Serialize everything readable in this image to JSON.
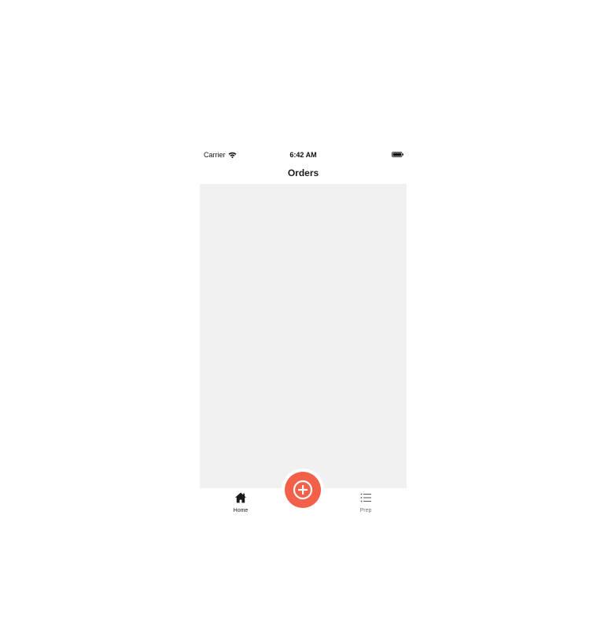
{
  "status_bar": {
    "carrier": "Carrier",
    "time": "6:42 AM",
    "wifi_icon": "wifi-icon",
    "battery_icon": "battery-icon"
  },
  "nav": {
    "title": "Orders"
  },
  "tabs": [
    {
      "label": "Home",
      "icon": "home-icon",
      "active": true
    },
    {
      "label": "Prep",
      "icon": "list-icon",
      "active": false
    }
  ],
  "fab": {
    "icon": "plus-circle-icon",
    "color": "#f2604a"
  },
  "colors": {
    "content_background": "#f1f1f1",
    "accent": "#f2604a"
  }
}
